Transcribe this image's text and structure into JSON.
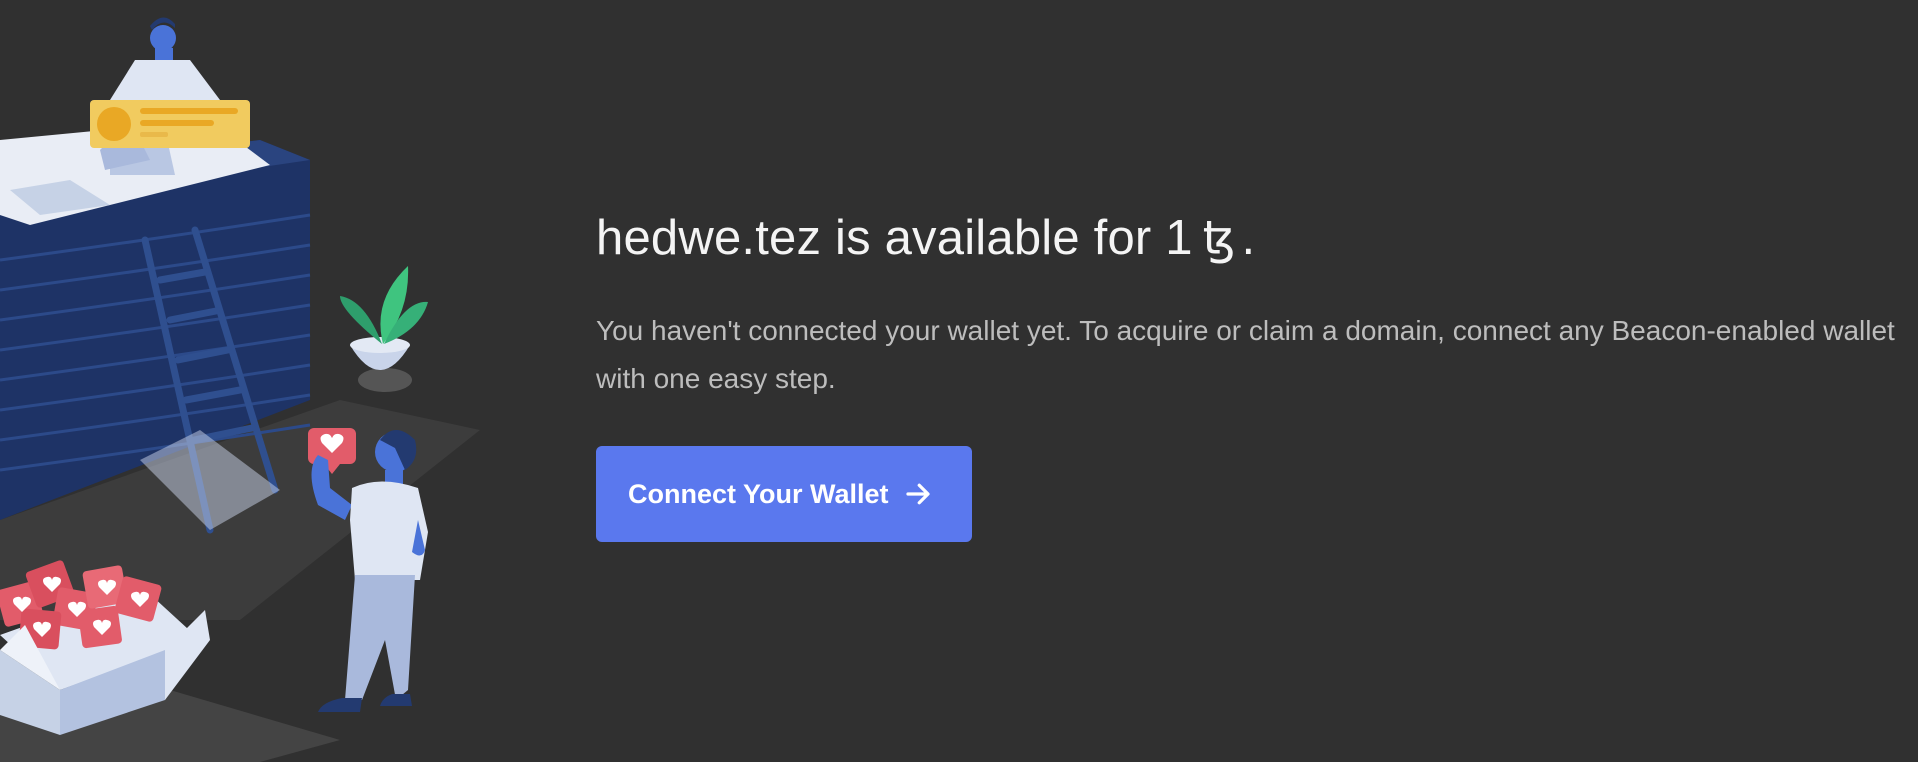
{
  "domain_status": {
    "domain_name": "hedwe.tez",
    "available_text": "is available for",
    "price": "1",
    "currency_symbol": "ꜩ",
    "period": "."
  },
  "wallet_notice": {
    "description": "You haven't connected your wallet yet. To acquire or claim a domain, connect any Beacon-enabled wallet with one easy step."
  },
  "actions": {
    "connect_label": "Connect Your Wallet",
    "connect_icon": "arrow-right-icon"
  },
  "colors": {
    "background": "#303030",
    "accent": "#5a78ee",
    "heading_text": "#f4f4f4",
    "body_text": "#bdbdbd"
  }
}
